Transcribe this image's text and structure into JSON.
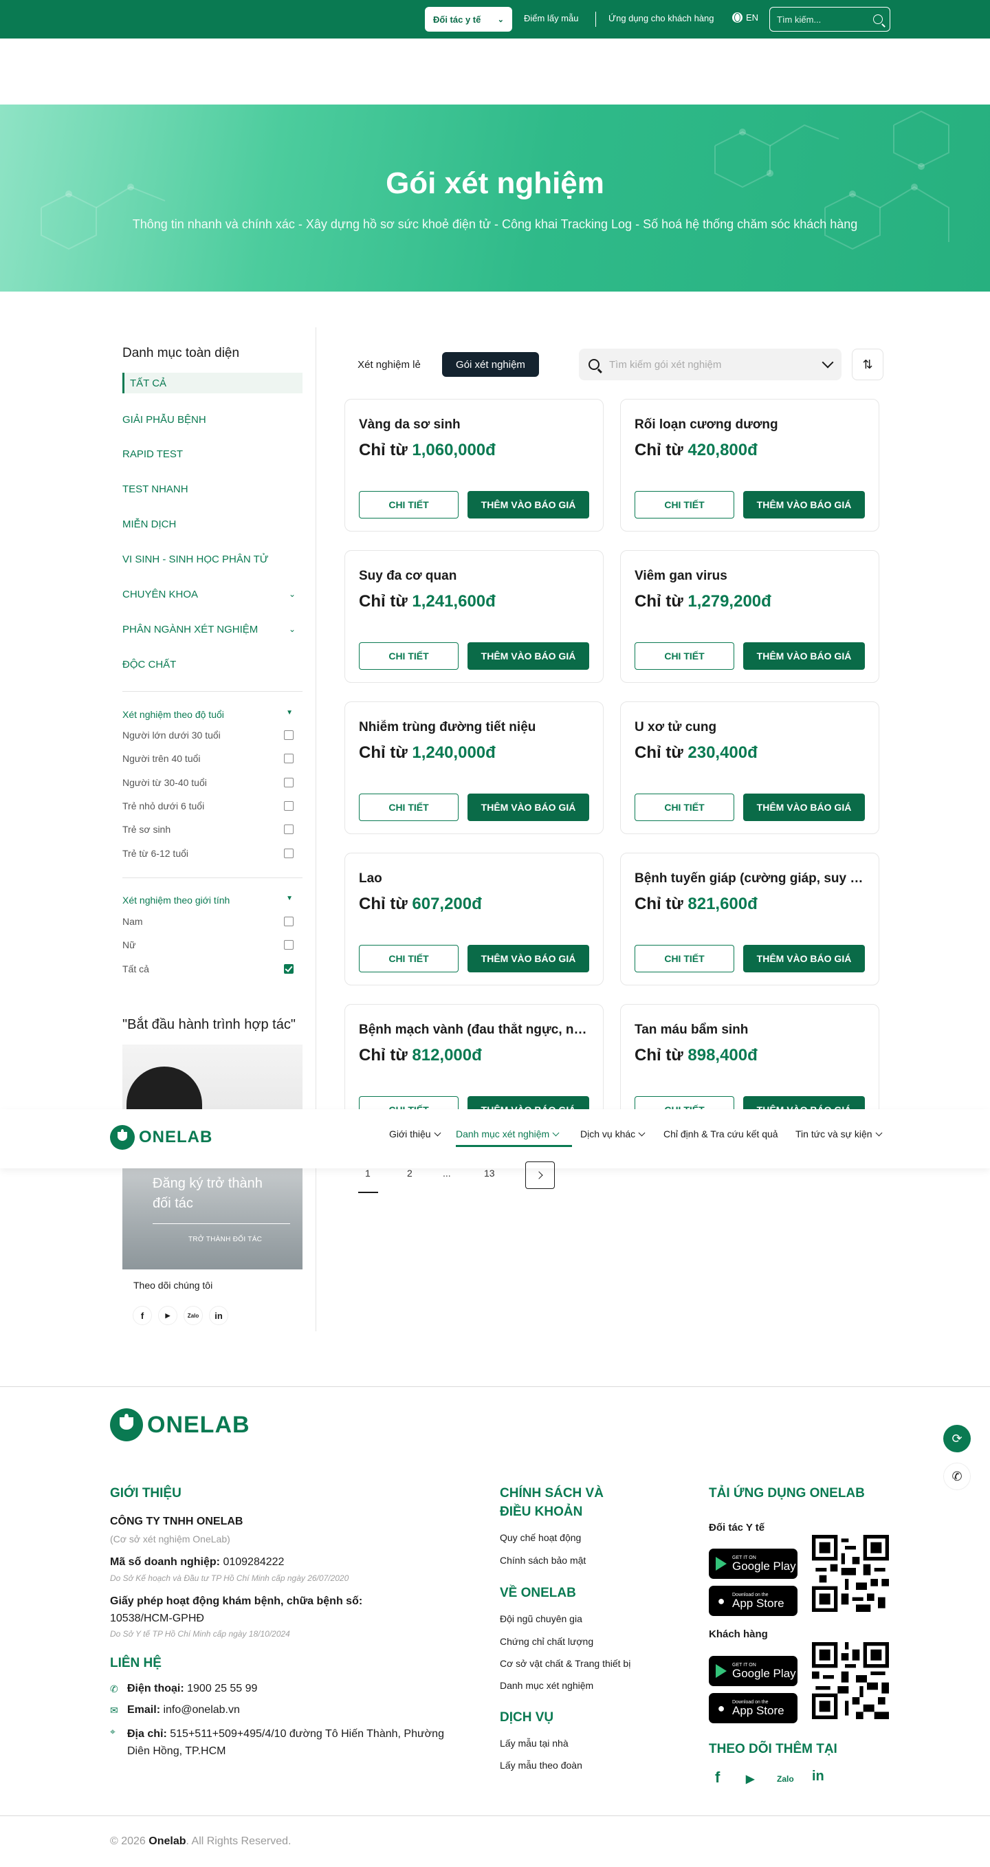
{
  "topbar": {
    "partner_label": "Đối tác y tế",
    "sample_points": "Điểm lấy mẫu",
    "customer_app": "Ứng dụng cho khách hàng",
    "lang": "EN",
    "search_placeholder": "Tìm kiếm..."
  },
  "hero": {
    "title": "Gói xét nghiệm",
    "subtitle": "Thông tin nhanh và chính xác - Xây dựng hồ sơ sức khoẻ điện tử - Công khai Tracking Log - Số hoá hệ thống chăm sóc khách hàng"
  },
  "sidebar": {
    "title": "Danh mục toàn diện",
    "categories": [
      {
        "label": "TẤT CẢ"
      },
      {
        "label": "GIẢI PHẪU BỆNH"
      },
      {
        "label": "RAPID TEST"
      },
      {
        "label": "TEST NHANH"
      },
      {
        "label": "MIỄN DỊCH"
      },
      {
        "label": "VI SINH - SINH HỌC PHÂN TỬ"
      },
      {
        "label": "CHUYÊN KHOA"
      },
      {
        "label": "PHÂN NGÀNH XÉT NGHIỆM"
      },
      {
        "label": "ĐỘC CHẤT"
      }
    ],
    "age_filter": {
      "title": "Xét nghiệm theo độ tuổi",
      "options": [
        {
          "label": "Người lớn dưới 30 tuổi",
          "checked": false
        },
        {
          "label": "Người trên 40 tuổi",
          "checked": false
        },
        {
          "label": "Người từ 30-40 tuổi",
          "checked": false
        },
        {
          "label": "Trẻ nhỏ dưới 6 tuổi",
          "checked": false
        },
        {
          "label": "Trẻ sơ sinh",
          "checked": false
        },
        {
          "label": "Trẻ từ 6-12 tuổi",
          "checked": false
        }
      ]
    },
    "gender_filter": {
      "title": "Xét nghiệm theo giới tính",
      "options": [
        {
          "label": "Nam",
          "checked": false
        },
        {
          "label": "Nữ",
          "checked": false
        },
        {
          "label": "Tất cả",
          "checked": true
        }
      ]
    },
    "quote": "\"Bắt đầu hành trình hợp tác\"",
    "promo_text": "Đăng ký trở thành đối tác",
    "promo_cta": "TRỞ THÀNH ĐỐI TÁC",
    "follow_label": "Theo dõi chúng tôi",
    "socials": [
      "f",
      "▶",
      "Zalo",
      "in"
    ]
  },
  "main": {
    "tab_single": "Xét nghiệm lẻ",
    "tab_package": "Gói xét nghiệm",
    "search_placeholder": "Tìm kiếm gói xét nghiệm",
    "price_prefix": "Chỉ từ",
    "detail_label": "CHI TIẾT",
    "add_label": "THÊM VÀO BÁO GIÁ",
    "cards": [
      {
        "title": "Vàng da sơ sinh",
        "price": "1,060,000đ"
      },
      {
        "title": "Rối loạn cương dương",
        "price": "420,800đ"
      },
      {
        "title": "Suy đa cơ quan",
        "price": "1,241,600đ"
      },
      {
        "title": "Viêm gan virus",
        "price": "1,279,200đ"
      },
      {
        "title": "Nhiễm trùng đường tiết niệu",
        "price": "1,240,000đ"
      },
      {
        "title": "U xơ tử cung",
        "price": "230,400đ"
      },
      {
        "title": "Lao",
        "price": "607,200đ"
      },
      {
        "title": "Bệnh tuyến giáp (cường giáp, suy giáp)",
        "price": "821,600đ"
      },
      {
        "title": "Bệnh mạch vành (đau thắt ngực, nhồi máu cơ tim)",
        "price": "812,000đ"
      },
      {
        "title": "Tan máu bẩm sinh",
        "price": "898,400đ"
      }
    ],
    "pagination": [
      "1",
      "2",
      "...",
      "13"
    ]
  },
  "nav": {
    "brand": "ONELAB",
    "items": [
      {
        "label": "Giới thiệu"
      },
      {
        "label": "Danh mục xét nghiệm"
      },
      {
        "label": "Dịch vụ khác"
      },
      {
        "label": "Chỉ định & Tra cứu kết quả"
      },
      {
        "label": "Tin tức và sự kiện"
      }
    ]
  },
  "footer": {
    "brand": "ONELAB",
    "intro_head": "GIỚI THIỆU",
    "company": "CÔNG TY TNHH ONELAB",
    "company_sub": "(Cơ sở xét nghiệm OneLab)",
    "tax_label": "Mã số doanh nghiệp:",
    "tax_value": "0109284222",
    "tax_note": "Do Sở Kế hoạch và Đầu tư TP Hồ Chí Minh cấp ngày 26/07/2020",
    "license_label": "Giấy phép hoạt động khám bệnh, chữa bệnh số:",
    "license_value": "10538/HCM-GPHĐ",
    "license_note": "Do Sở Y tế TP Hồ Chí Minh cấp ngày 18/10/2024",
    "contact_head": "LIÊN HỆ",
    "phone_label": "Điện thoại:",
    "phone": "1900 25 55 99",
    "email_label": "Email:",
    "email": "info@onelab.vn",
    "address_label": "Địa chỉ:",
    "address_line1": "515+511+509+495/4/10 đường Tô Hiến Thành, Phường",
    "address_line2": "Diên Hồng, TP.HCM",
    "policy_head_1": "CHÍNH SÁCH VÀ",
    "policy_head_2": "ĐIỀU KHOẢN",
    "policy_links": [
      "Quy chế hoạt động",
      "Chính sách bảo mật"
    ],
    "about_head": "VỀ ONELAB",
    "about_links": [
      "Đội ngũ chuyên gia",
      "Chứng chỉ chất lượng",
      "Cơ sở vật chất & Trang thiết bị",
      "Danh mục xét nghiệm"
    ],
    "service_head": "DỊCH VỤ",
    "service_links": [
      "Lấy mẫu tại nhà",
      "Lấy mẫu theo đoàn"
    ],
    "app_head": "TẢI ỨNG DỤNG ONELAB",
    "partner_label": "Đối tác Y tế",
    "customer_label": "Khách hàng",
    "gplay_small": "GET IT ON",
    "gplay_big": "Google Play",
    "appstore_small": "Download on the",
    "appstore_big": "App Store",
    "follow_head": "THEO DÕI THÊM TẠI",
    "socials": [
      "f",
      "▶",
      "Zalo",
      "in"
    ],
    "copyright_pre": "© 2026",
    "copyright_brand": "Onelab",
    "copyright_post": ". All Rights Reserved."
  },
  "colors": {
    "primary": "#0a7a52",
    "dark_button": "#0a6b48",
    "tab_active": "#14232f"
  }
}
